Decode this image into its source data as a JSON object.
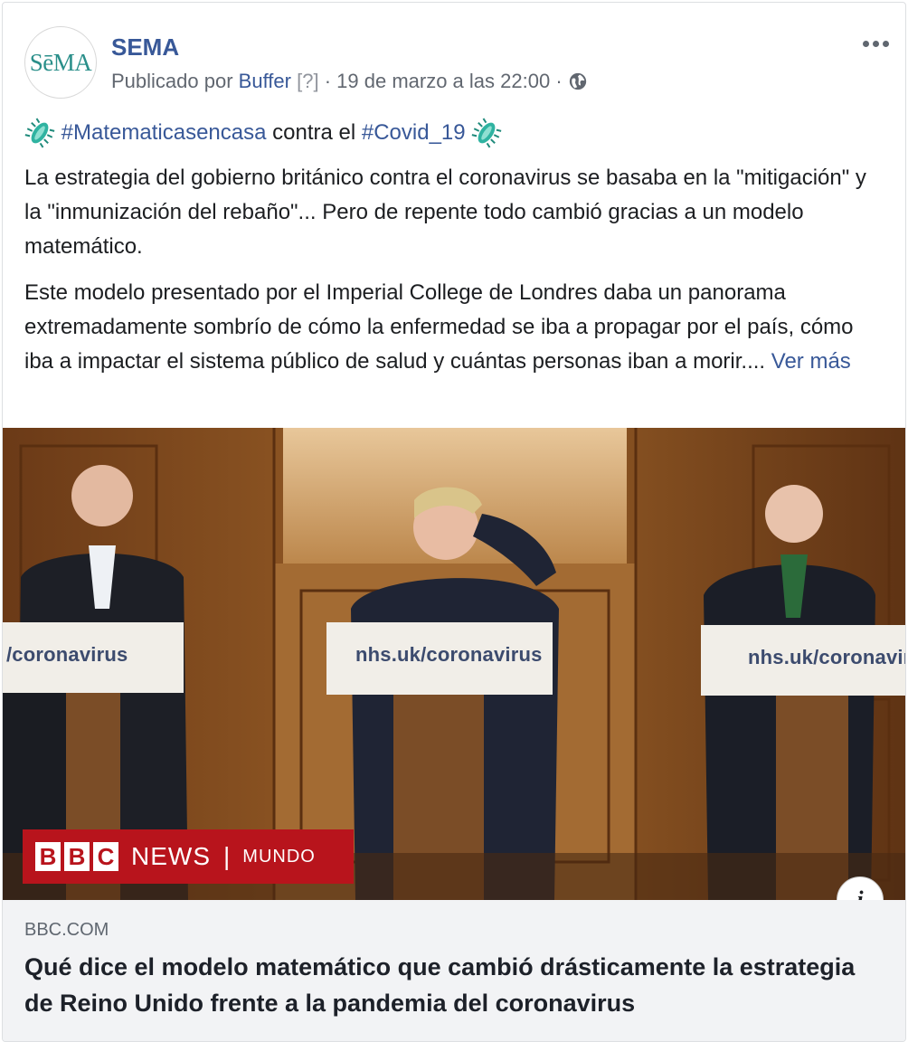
{
  "post": {
    "page_name": "SEMA",
    "avatar_text": "SēMA",
    "meta": {
      "published_by": "Publicado por",
      "publisher": "Buffer",
      "help_marker": "[?]",
      "separator": "·",
      "date": "19 de marzo a las 22:00",
      "separator2": "·"
    },
    "hashtag_line": {
      "tag1": "#Matematicasencasa",
      "middle": "contra el",
      "tag2": "#Covid_19"
    },
    "paragraph1": "La estrategia del gobierno británico contra el coronavirus se basaba en la \"mitigación\" y la \"inmunización del rebaño\"... Pero de repente todo cambió gracias a un modelo matemático.",
    "paragraph2": "Este modelo presentado por el Imperial College de Londres daba un panorama extremadamente sombrío de cómo la enfermedad se iba a propagar por el país, cómo iba a impactar el sistema público de salud y cuántas personas iban a morir....",
    "see_more": "Ver más"
  },
  "image": {
    "podium_left": "/coronavirus",
    "podium_center": "nhs.uk/coronavirus",
    "podium_right": "nhs.uk/coronavirus",
    "banner": {
      "b1": "B",
      "b2": "B",
      "b3": "C",
      "news": "NEWS",
      "sep": "|",
      "mundo": "MUNDO"
    },
    "info_label": "i"
  },
  "link_preview": {
    "domain": "BBC.COM",
    "title": "Qué dice el modelo matemático que cambió drásticamente la estrategia de Reino Unido frente a la pandemia del coronavirus"
  },
  "icons": [
    "globe-icon",
    "more-options-icon",
    "virus-icon",
    "info-icon"
  ],
  "colors": {
    "link": "#385898",
    "meta": "#616770",
    "bbc_red": "#b8141c",
    "preview_bg": "#f2f3f5"
  }
}
